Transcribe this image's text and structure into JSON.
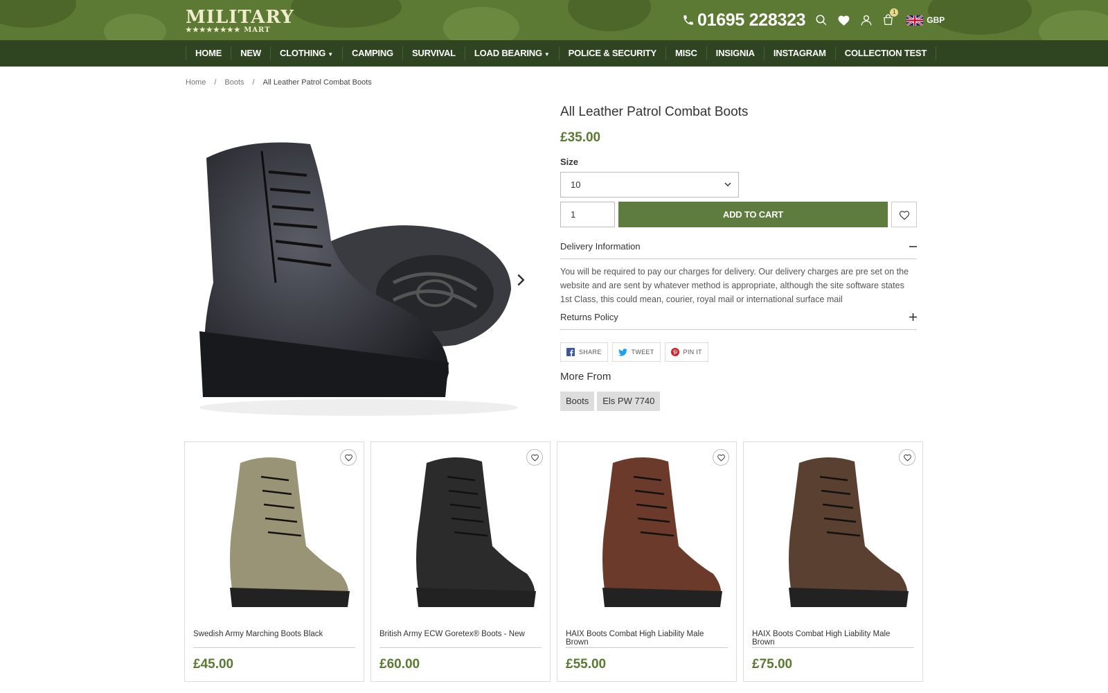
{
  "header": {
    "logo_main": "MILITARY",
    "logo_sub": "★★★★★★★★ MART",
    "phone": "01695 228323",
    "cart_count": "1",
    "currency": "GBP",
    "bg_color": "#5d7a35"
  },
  "nav": {
    "items": [
      {
        "label": "HOME"
      },
      {
        "label": "NEW"
      },
      {
        "label": "CLOTHING",
        "dropdown": true
      },
      {
        "label": "CAMPING"
      },
      {
        "label": "SURVIVAL"
      },
      {
        "label": "LOAD BEARING",
        "dropdown": true
      },
      {
        "label": "POLICE & SECURITY"
      },
      {
        "label": "MISC"
      },
      {
        "label": "INSIGNIA"
      },
      {
        "label": "INSTAGRAM"
      },
      {
        "label": "COLLECTION TEST"
      }
    ],
    "bg_color": "#2f4420"
  },
  "breadcrumb": {
    "home": "Home",
    "category": "Boots",
    "current": "All Leather Patrol Combat Boots"
  },
  "product": {
    "title": "All Leather Patrol Combat Boots",
    "price": "£35.00",
    "size_label": "Size",
    "size_value": "10",
    "quantity": "1",
    "add_to_cart": "ADD TO CART",
    "delivery_title": "Delivery Information",
    "delivery_text": "You will be required to pay our charges for delivery. Our delivery charges are pre set on the website and are sent by whatever method is appropriate, although the site software states 1st Class, this could mean, courier, royal mail or international surface mail",
    "returns_title": "Returns Policy",
    "share": {
      "facebook": "SHARE",
      "twitter": "TWEET",
      "pinterest": "PIN IT"
    },
    "more_from_title": "More From",
    "tags": [
      "Boots",
      "Els PW 7740"
    ],
    "accent_color": "#5e7c3e"
  },
  "related": [
    {
      "name": "Swedish Army Marching Boots Black",
      "price": "£45.00",
      "color": "#9a9477"
    },
    {
      "name": "British Army ECW Goretex® Boots - New",
      "price": "£60.00",
      "color": "#2b2b2b"
    },
    {
      "name": "HAIX Boots Combat High Liability Male Brown",
      "price": "£55.00",
      "color": "#6b3a2a"
    },
    {
      "name": "HAIX Boots Combat High Liability Male Brown",
      "price": "£75.00",
      "color": "#5a4030"
    }
  ]
}
